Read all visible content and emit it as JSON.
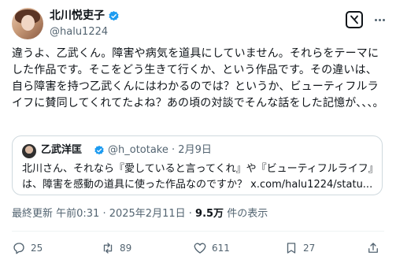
{
  "author": {
    "name": "北川悦吏子",
    "handle": "@halu1224"
  },
  "post": {
    "text": "違うよ、乙武くん。障害や病気を道具にしていません。それらをテーマにした作品です。そこをどう生きて行くか、という作品です。その違いは、自ら障害を持つ乙武くんにはわかるのでは？というか、ビューティフルライフに賛同してくれてたよね？あの頃の対談でそんな話をした記憶が、、、。"
  },
  "quote": {
    "name": "乙武洋匡",
    "handle": "@h_ototake",
    "separator": "·",
    "date": "2月9日",
    "text": "北川さん、それなら『愛していると言ってくれ』や『ビューティフルライフ』は、障害を感動の道具に使った作品なのですか？ ",
    "link": "x.com/halu1224/statu..."
  },
  "meta": {
    "prefix": "最終更新 午前0:31 · 2025年2月11日 · ",
    "views": "9.5万",
    "views_suffix": " 件の表示"
  },
  "actions": {
    "replies": "25",
    "reposts": "89",
    "likes": "611",
    "bookmarks": "27"
  },
  "colors": {
    "verified": "#1d9bf0",
    "secondary_text": "#536471",
    "border": "#cfd9de"
  },
  "icons": [
    "verified-badge-icon",
    "grok-icon",
    "more-icon",
    "reply-icon",
    "repost-icon",
    "like-icon",
    "bookmark-icon",
    "share-icon"
  ]
}
